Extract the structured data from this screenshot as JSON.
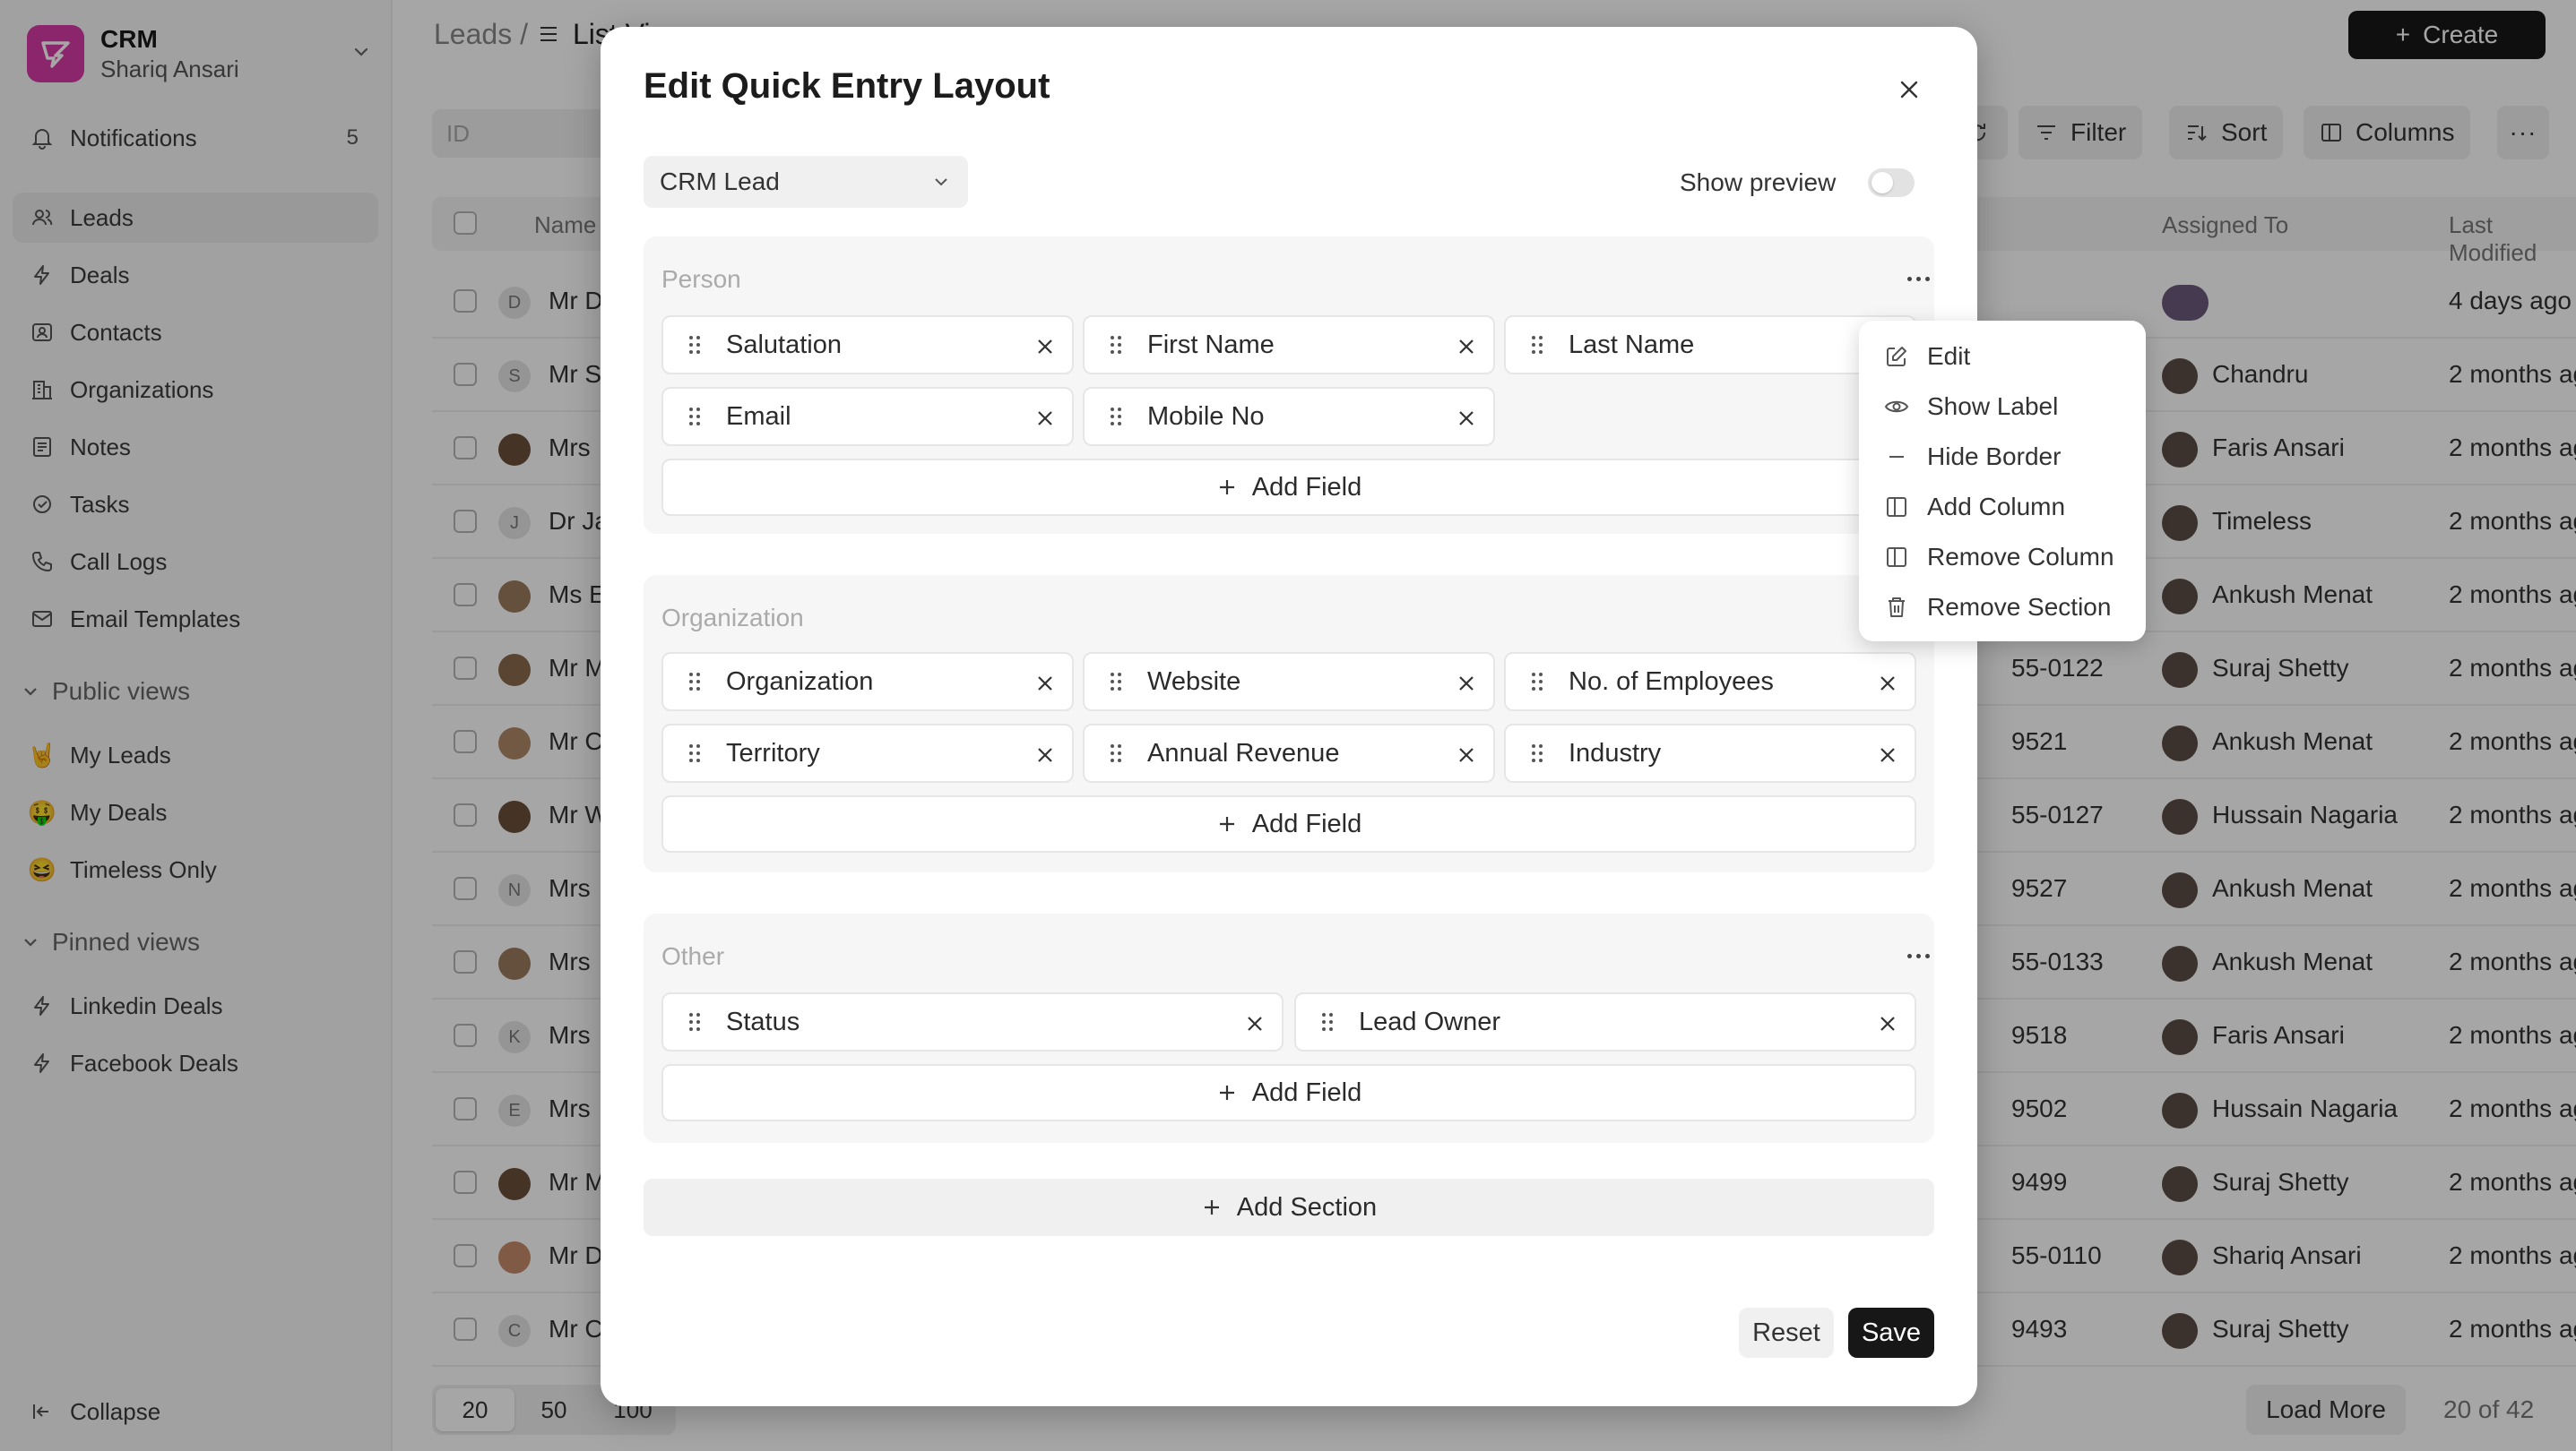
{
  "brand": {
    "name": "CRM",
    "user": "Shariq Ansari"
  },
  "sidebar": {
    "notifications": {
      "label": "Notifications",
      "count": "5"
    },
    "items": [
      {
        "label": "Leads",
        "icon": "users-icon"
      },
      {
        "label": "Deals",
        "icon": "zap-icon"
      },
      {
        "label": "Contacts",
        "icon": "contact-icon"
      },
      {
        "label": "Organizations",
        "icon": "building-icon"
      },
      {
        "label": "Notes",
        "icon": "note-icon"
      },
      {
        "label": "Tasks",
        "icon": "check-circle-icon"
      },
      {
        "label": "Call Logs",
        "icon": "phone-icon"
      },
      {
        "label": "Email Templates",
        "icon": "mail-icon"
      }
    ],
    "public_heading": "Public views",
    "public_views": [
      {
        "emoji": "🤘",
        "label": "My Leads"
      },
      {
        "emoji": "🤑",
        "label": "My Deals"
      },
      {
        "emoji": "😆",
        "label": "Timeless Only"
      }
    ],
    "pinned_heading": "Pinned views",
    "pinned_views": [
      {
        "label": "Linkedin Deals"
      },
      {
        "label": "Facebook Deals"
      }
    ],
    "collapse": "Collapse"
  },
  "header": {
    "crumb_root": "Leads /",
    "crumb_current": "List Vi",
    "create": "Create"
  },
  "toolbar": {
    "search_placeholder": "ID",
    "filter": "Filter",
    "sort": "Sort",
    "columns": "Columns"
  },
  "table": {
    "columns": {
      "name": "Name",
      "assigned": "Assigned To",
      "modified": "Last Modified"
    },
    "rows": [
      {
        "avatar": "D",
        "name": "Mr D",
        "phone": "",
        "assigned": "",
        "modified": "4 days ago"
      },
      {
        "avatar": "S",
        "name": "Mr S",
        "phone": "",
        "assigned": "Chandru",
        "modified": "2 months ago"
      },
      {
        "avatar": "",
        "name": "Mrs",
        "phone": "",
        "assigned": "Faris Ansari",
        "modified": "2 months ago"
      },
      {
        "avatar": "J",
        "name": "Dr Ja",
        "phone": "",
        "assigned": "Timeless",
        "modified": "2 months ago"
      },
      {
        "avatar": "",
        "name": "Ms E",
        "phone": "",
        "assigned": "Ankush Menat",
        "modified": "2 months ago"
      },
      {
        "avatar": "",
        "name": "Mr M",
        "phone": "55-0122",
        "assigned": "Suraj Shetty",
        "modified": "2 months ago"
      },
      {
        "avatar": "",
        "name": "Mr C",
        "phone": "9521",
        "assigned": "Ankush Menat",
        "modified": "2 months ago"
      },
      {
        "avatar": "",
        "name": "Mr W",
        "phone": "55-0127",
        "assigned": "Hussain Nagaria",
        "modified": "2 months ago"
      },
      {
        "avatar": "N",
        "name": "Mrs",
        "phone": "9527",
        "assigned": "Ankush Menat",
        "modified": "2 months ago"
      },
      {
        "avatar": "",
        "name": "Mrs",
        "phone": "55-0133",
        "assigned": "Ankush Menat",
        "modified": "2 months ago"
      },
      {
        "avatar": "K",
        "name": "Mrs",
        "phone": "9518",
        "assigned": "Faris Ansari",
        "modified": "2 months ago"
      },
      {
        "avatar": "E",
        "name": "Mrs",
        "phone": "9502",
        "assigned": "Hussain Nagaria",
        "modified": "2 months ago"
      },
      {
        "avatar": "",
        "name": "Mr M",
        "phone": "9499",
        "assigned": "Suraj Shetty",
        "modified": "2 months ago"
      },
      {
        "avatar": "",
        "name": "Mr D",
        "phone": "55-0110",
        "assigned": "Shariq Ansari",
        "modified": "2 months ago"
      },
      {
        "avatar": "C",
        "name": "Mr C",
        "phone": "9493",
        "assigned": "Suraj Shetty",
        "modified": "2 months ago"
      }
    ]
  },
  "footer": {
    "page_sizes": [
      "20",
      "50",
      "100"
    ],
    "load_more": "Load More",
    "count": "20 of 42"
  },
  "modal": {
    "title": "Edit Quick Entry Layout",
    "doctype": "CRM Lead",
    "show_preview": "Show preview",
    "add_field": "Add Field",
    "add_section": "Add Section",
    "reset": "Reset",
    "save": "Save",
    "sections": [
      {
        "title": "Person",
        "fields": [
          "Salutation",
          "First Name",
          "Last Name",
          "Email",
          "Mobile No"
        ]
      },
      {
        "title": "Organization",
        "fields": [
          "Organization",
          "Website",
          "No. of Employees",
          "Territory",
          "Annual Revenue",
          "Industry"
        ]
      },
      {
        "title": "Other",
        "fields": [
          "Status",
          "Lead Owner"
        ]
      }
    ]
  },
  "menu": {
    "items": [
      "Edit",
      "Show Label",
      "Hide Border",
      "Add Column",
      "Remove Column",
      "Remove Section"
    ]
  }
}
